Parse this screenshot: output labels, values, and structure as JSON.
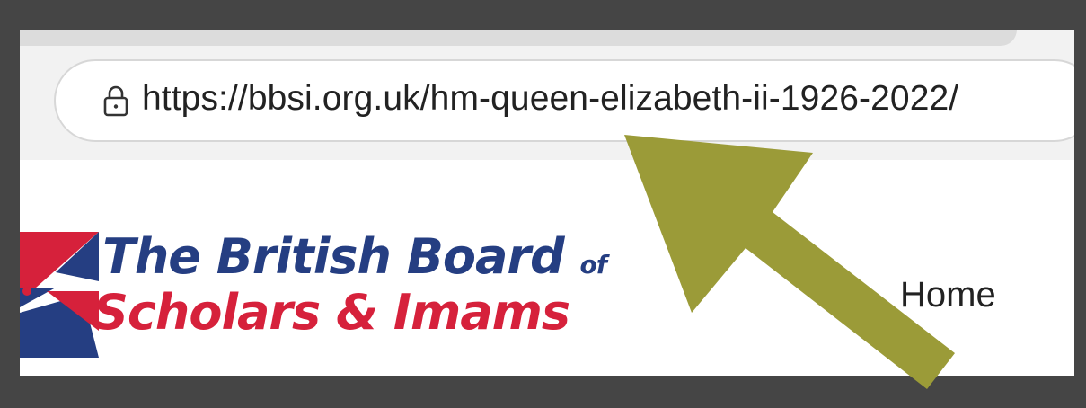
{
  "browser": {
    "url": "https://bbsi.org.uk/hm-queen-elizabeth-ii-1926-2022/",
    "lock_icon": "lock-icon"
  },
  "site": {
    "logo_line1": "The British Board",
    "logo_of": "of",
    "logo_line2": "Scholars & Imams",
    "nav": {
      "home": "Home"
    }
  },
  "colors": {
    "background": "#454545",
    "logo_blue": "#253e82",
    "logo_red": "#d6213b",
    "arrow": "#9b9b38"
  }
}
